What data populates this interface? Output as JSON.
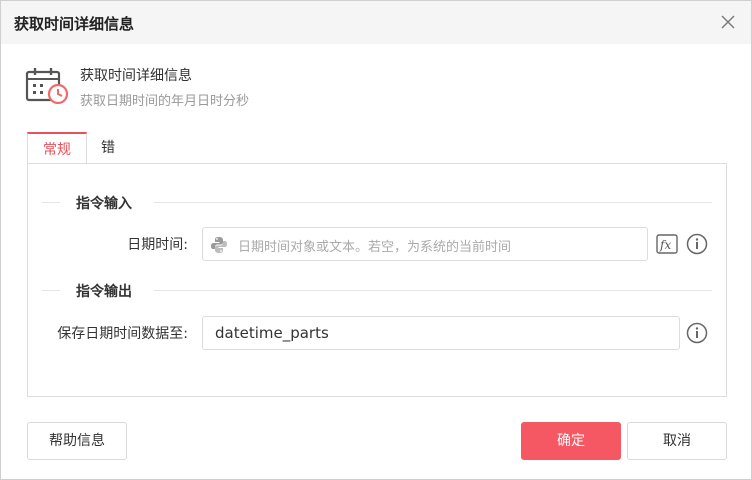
{
  "dialog": {
    "title": "获取时间详细信息",
    "close_icon": "close-icon"
  },
  "header": {
    "icon": "calendar-clock-icon",
    "title": "获取时间详细信息",
    "description": "获取日期时间的年月日时分秒"
  },
  "tabs": [
    {
      "label": "常规",
      "active": true
    },
    {
      "label": "错误处理",
      "active": false
    }
  ],
  "sections": {
    "input": {
      "title": "指令输入",
      "field_label": "日期时间:",
      "placeholder": "日期时间对象或文本。若空，为系统的当前时间",
      "value": "",
      "prefix_icon": "python-icon",
      "fx_icon": "fx-icon",
      "info_icon": "info-icon"
    },
    "output": {
      "title": "指令输出",
      "field_label": "保存日期时间数据至:",
      "value": "datetime_parts",
      "info_icon": "info-icon"
    }
  },
  "footer": {
    "help_label": "帮助信息",
    "ok_label": "确定",
    "cancel_label": "取消"
  },
  "colors": {
    "accent": "#f65863",
    "active_tab": "#e8505b",
    "icon_gray": "#555555"
  }
}
